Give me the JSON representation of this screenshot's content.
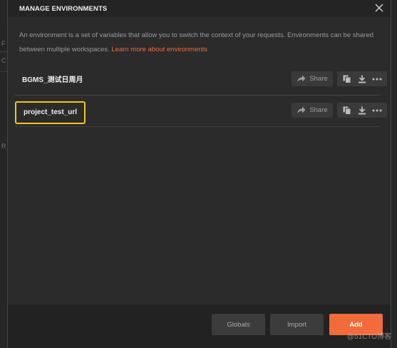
{
  "modal": {
    "title": "MANAGE ENVIRONMENTS",
    "description": "An environment is a set of variables that allow you to switch the context of your requests. Environments can be shared between multiple workspaces.",
    "learn_more": "Learn more about environments"
  },
  "environments": [
    {
      "name": "BGMS_测试日周月",
      "share_label": "Share",
      "highlighted": false
    },
    {
      "name": "project_test_url",
      "share_label": "Share",
      "highlighted": true
    }
  ],
  "footer": {
    "globals_label": "Globals",
    "import_label": "Import",
    "add_label": "Add"
  },
  "watermark": "@51CTO博客",
  "colors": {
    "accent": "#f26b3a",
    "highlight_border": "#f5c518",
    "background": "#2b2b2b"
  },
  "icons": [
    "close-icon",
    "share-arrow-icon",
    "duplicate-icon",
    "download-icon",
    "more-icon"
  ]
}
